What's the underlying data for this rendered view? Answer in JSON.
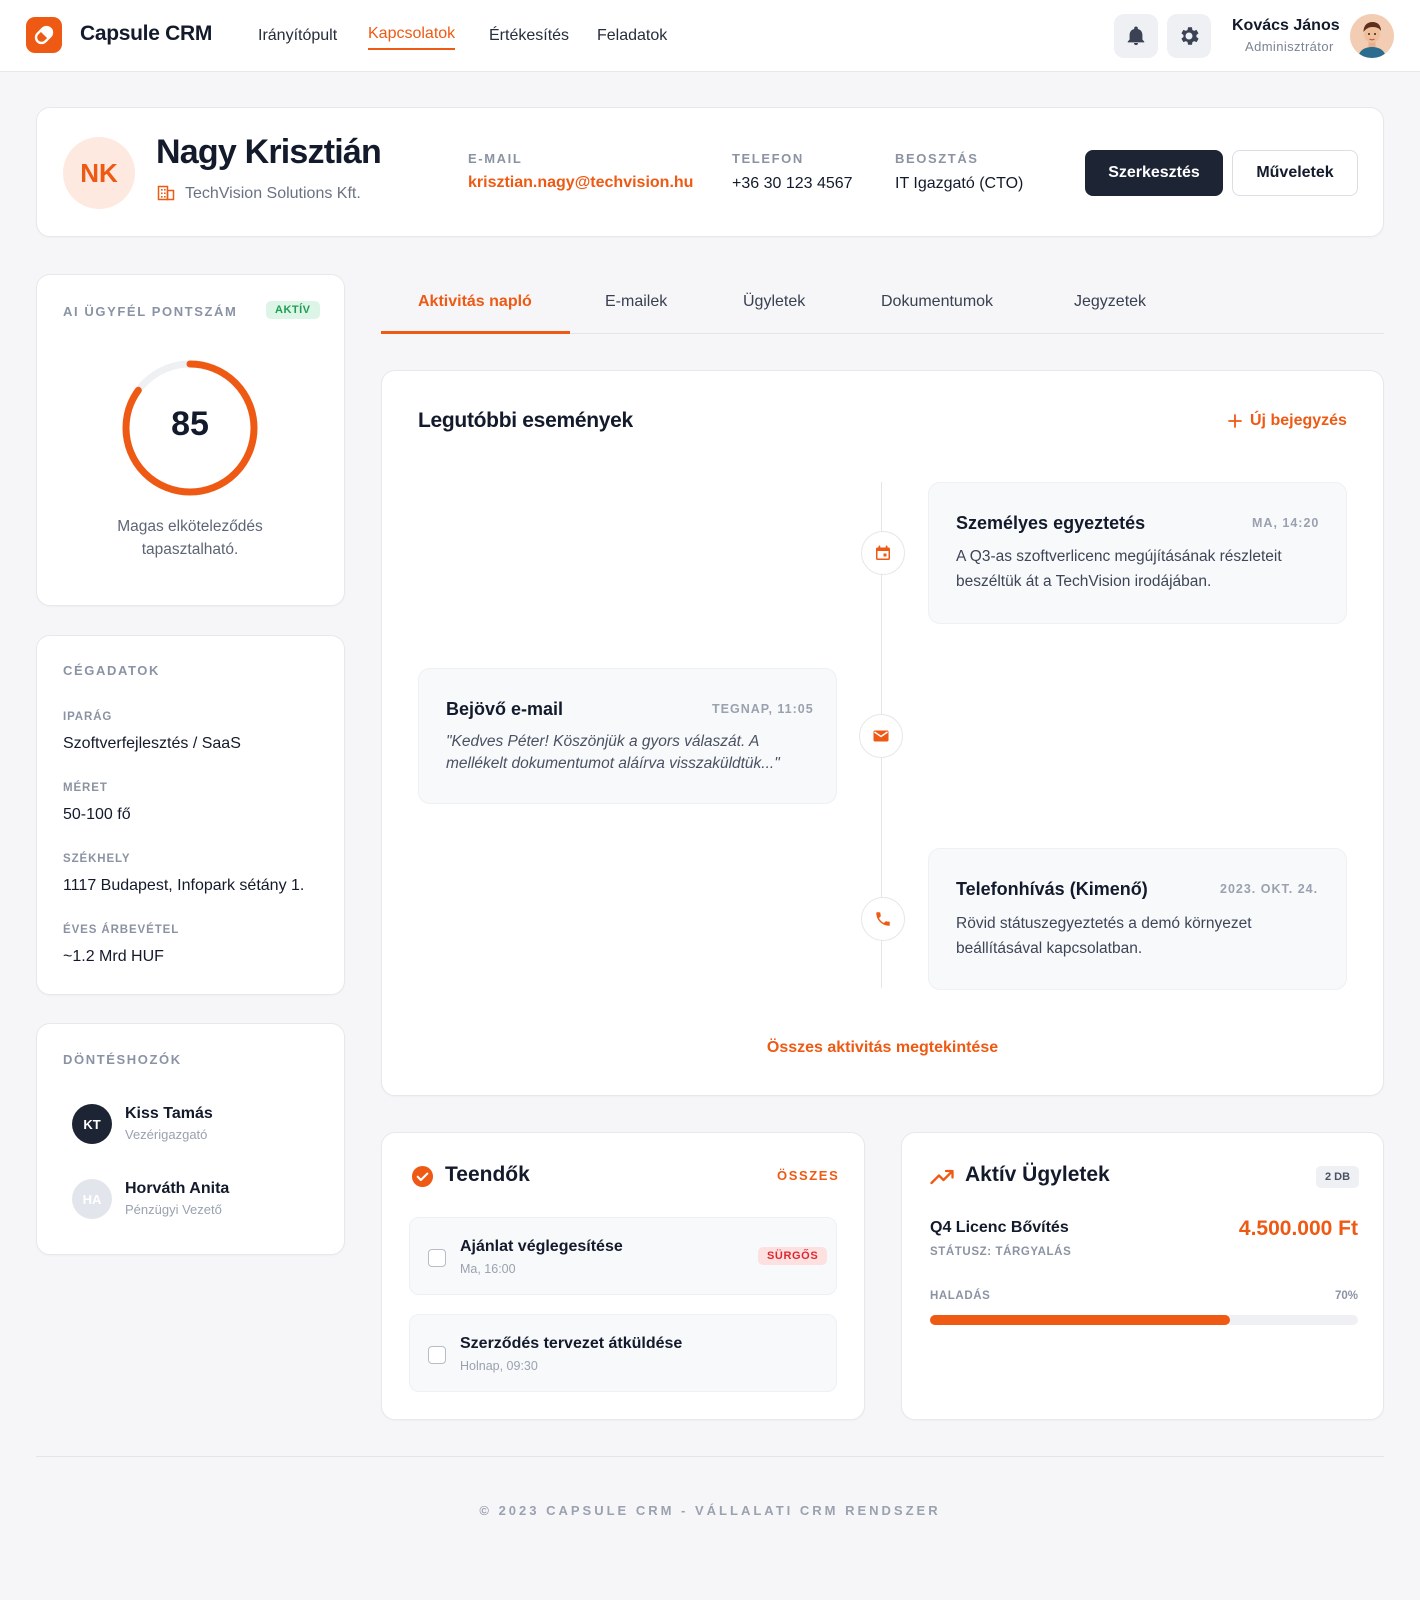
{
  "app": {
    "brand": "Capsule CRM"
  },
  "nav": {
    "items": [
      "Irányítópult",
      "Kapcsolatok",
      "Értékesítés",
      "Feladatok"
    ],
    "active": "Kapcsolatok"
  },
  "user": {
    "name": "Kovács János",
    "role": "Adminisztrátor"
  },
  "contact": {
    "initials": "NK",
    "name": "Nagy Krisztián",
    "company": "TechVision Solutions Kft.",
    "email_label": "E-MAIL",
    "email": "krisztian.nagy@techvision.hu",
    "phone_label": "TELEFON",
    "phone": "+36 30 123 4567",
    "position_label": "BEOSZTÁS",
    "position": "IT Igazgató (CTO)",
    "edit_label": "Szerkesztés",
    "actions_label": "Műveletek"
  },
  "score": {
    "title": "AI ÜGYFÉL PONTSZÁM",
    "badge": "AKTÍV",
    "value": "85",
    "percent": 85,
    "text_line1": "Magas elköteleződés",
    "text_line2": "tapasztalható."
  },
  "company": {
    "title": "CÉGADATOK",
    "fields": [
      {
        "label": "IPARÁG",
        "value": "Szoftverfejlesztés / SaaS"
      },
      {
        "label": "MÉRET",
        "value": "50-100 fő"
      },
      {
        "label": "SZÉKHELY",
        "value": "1117 Budapest, Infopark sétány 1."
      },
      {
        "label": "ÉVES ÁRBEVÉTEL",
        "value": "~1.2 Mrd HUF"
      }
    ]
  },
  "decision_makers": {
    "title": "DÖNTÉSHOZÓK",
    "people": [
      {
        "initials": "KT",
        "name": "Kiss Tamás",
        "role": "Vezérigazgató"
      },
      {
        "initials": "HA",
        "name": "Horváth Anita",
        "role": "Pénzügyi Vezető"
      }
    ]
  },
  "tabs": [
    "Aktivitás napló",
    "E-mailek",
    "Ügyletek",
    "Dokumentumok",
    "Jegyzetek"
  ],
  "activity": {
    "title": "Legutóbbi események",
    "new_entry": "Új bejegyzés",
    "events": [
      {
        "icon": "calendar-icon",
        "title": "Személyes egyeztetés",
        "time": "MA, 14:20",
        "line1": "A Q3-as szoftverlicenc megújításának részleteit",
        "line2": "beszéltük át a TechVision irodájában."
      },
      {
        "icon": "mail-icon",
        "title": "Bejövő e-mail",
        "time": "TEGNAP, 11:05",
        "line1": "\"Kedves Péter! Köszönjük a gyors válaszát. A",
        "line2": "mellékelt dokumentumot aláírva visszaküldtük...\""
      },
      {
        "icon": "phone-icon",
        "title": "Telefonhívás (Kimenő)",
        "time": "2023. OKT. 24.",
        "line1": "Rövid státuszegyeztetés a demó környezet",
        "line2": "beállításával kapcsolatban."
      }
    ],
    "view_all": "Összes aktivitás megtekintése"
  },
  "tasks": {
    "title": "Teendők",
    "all_label": "ÖSSZES",
    "items": [
      {
        "title": "Ajánlat véglegesítése",
        "due": "Ma, 16:00",
        "badge": "SÜRGŐS"
      },
      {
        "title": "Szerződés tervezet átküldése",
        "due": "Holnap, 09:30",
        "badge": ""
      }
    ]
  },
  "deals": {
    "title": "Aktív Ügyletek",
    "count_badge": "2 DB",
    "deal_name": "Q4 Licenc Bővítés",
    "deal_status": "STÁTUSZ: TÁRGYALÁS",
    "amount": "4.500.000 Ft",
    "progress_label": "HALADÁS",
    "progress_text": "70%",
    "progress": 0.7
  },
  "footer": {
    "text": "© 2023 CAPSULE CRM - VÁLLALATI CRM RENDSZER"
  },
  "colors": {
    "accent": "#ee5a14",
    "dark": "#1d2434",
    "success": "#1f9d55",
    "urgent": "#e0262f"
  }
}
